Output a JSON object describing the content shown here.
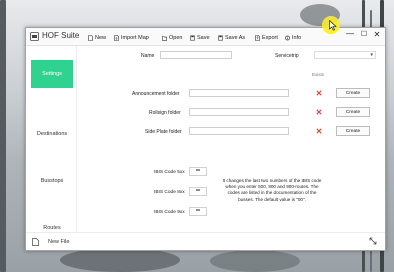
{
  "app": {
    "title": "HOF Suite"
  },
  "toolbar": {
    "items": [
      {
        "label": "New",
        "icon": "new-file-icon"
      },
      {
        "label": "Import Map",
        "icon": "import-icon"
      },
      {
        "label": "Open",
        "icon": "folder-icon"
      },
      {
        "label": "Save",
        "icon": "save-icon"
      },
      {
        "label": "Save As",
        "icon": "save-as-icon"
      },
      {
        "label": "Export",
        "icon": "export-icon"
      },
      {
        "label": "Info",
        "icon": "info-icon"
      }
    ]
  },
  "window_controls": {
    "minimize": "—",
    "maximize": "☐",
    "close": "✕"
  },
  "sidebar": {
    "items": [
      {
        "label": "Settings",
        "active": true
      },
      {
        "label": "Destinations",
        "active": false
      },
      {
        "label": "Busstops",
        "active": false
      },
      {
        "label": "Routes",
        "active": false
      }
    ]
  },
  "settings": {
    "name_label": "Name",
    "name_value": "",
    "servicetrip_label": "Servicetrip",
    "servicetrip_value": "",
    "column_header": "Exists",
    "folders": [
      {
        "label": "Announcement folder",
        "value": "",
        "exists": false,
        "button": "Create"
      },
      {
        "label": "Rollsign folder",
        "value": "",
        "exists": false,
        "button": "Create"
      },
      {
        "label": "Side Plate folder",
        "value": "",
        "exists": false,
        "button": "Create"
      }
    ],
    "ibis_codes": [
      {
        "label": "IBIS Code 5xx",
        "value": "**"
      },
      {
        "label": "IBIS Code 8xx",
        "value": "**"
      },
      {
        "label": "IBIS Code 9xx",
        "value": "**"
      }
    ],
    "info_text": "It changes the last two numbers of the IBIS code when you enter 500, 800 and 900-routes. The codes are listed in the documentation of the busses. The default value is \"00\"."
  },
  "bottom": {
    "new_file_label": "New File"
  },
  "colors": {
    "accent": "#2fd38f",
    "error": "#e0453a"
  }
}
